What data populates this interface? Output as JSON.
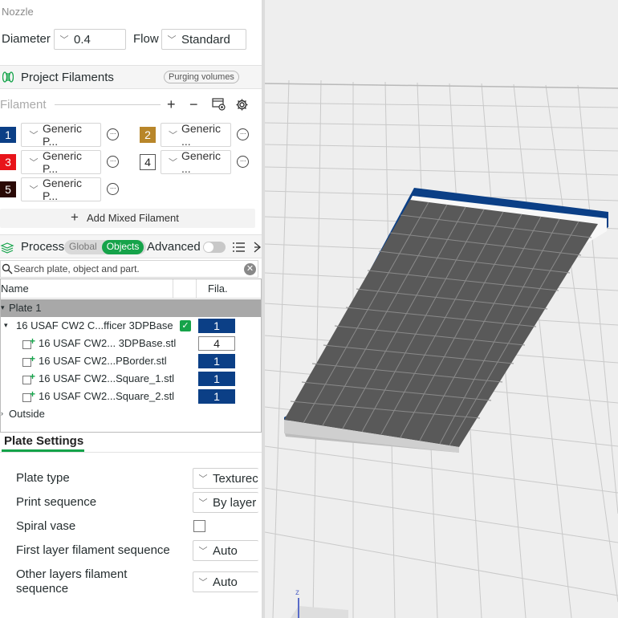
{
  "nozzle": {
    "title": "Nozzle",
    "diameter_label": "Diameter",
    "diameter_value": "0.4",
    "flow_label": "Flow",
    "flow_value": "Standard"
  },
  "project_filaments": {
    "title": "Project Filaments",
    "purging_button": "Purging volumes"
  },
  "filament": {
    "header_label": "Filament",
    "items": [
      {
        "num": "1",
        "name": "Generic P...",
        "color": "#0b3f86",
        "text_color": "#ffffff"
      },
      {
        "num": "2",
        "name": "Generic ...",
        "color": "#b8862a",
        "text_color": "#ffffff"
      },
      {
        "num": "3",
        "name": "Generic P...",
        "color": "#e8141a",
        "text_color": "#ffffff"
      },
      {
        "num": "4",
        "name": "Generic ...",
        "color": "#ffffff",
        "text_color": "#222222"
      },
      {
        "num": "5",
        "name": "Generic P...",
        "color": "#2a0a06",
        "text_color": "#ffffff"
      }
    ],
    "add_mixed": "Add Mixed Filament"
  },
  "process": {
    "title": "Process",
    "tab_global": "Global",
    "tab_objects": "Objects",
    "advanced_label": "Advanced"
  },
  "search": {
    "placeholder": "Search plate, object and part."
  },
  "tree": {
    "col_name": "Name",
    "col_fila": "Fila.",
    "plate": "Plate 1",
    "object": {
      "name": "16 USAF CW2 C...fficer 3DPBase",
      "fila": "1"
    },
    "parts": [
      {
        "name": "16 USAF CW2... 3DPBase.stl",
        "fila": "4"
      },
      {
        "name": "16 USAF CW2...PBorder.stl",
        "fila": "1"
      },
      {
        "name": "16 USAF CW2...Square_1.stl",
        "fila": "1"
      },
      {
        "name": "16 USAF CW2...Square_2.stl",
        "fila": "1"
      }
    ],
    "outside": "Outside"
  },
  "plate_settings": {
    "title": "Plate Settings",
    "plate_type_label": "Plate type",
    "plate_type_value": "Texturec",
    "print_sequence_label": "Print sequence",
    "print_sequence_value": "By layer",
    "spiral_vase_label": "Spiral vase",
    "first_layer_label": "First layer filament sequence",
    "first_layer_value": "Auto",
    "other_layers_label_1": "Other layers filament",
    "other_layers_label_2": "sequence",
    "other_layers_value": "Auto"
  },
  "viewport": {
    "axis_label": "z"
  },
  "icons": [
    "spool-icon",
    "plus-icon",
    "minus-icon",
    "filament-sync-icon",
    "gear-icon",
    "more-icon",
    "layers-icon",
    "list-icon",
    "split-icon",
    "search-icon",
    "clear-icon",
    "check-icon",
    "part-icon"
  ]
}
